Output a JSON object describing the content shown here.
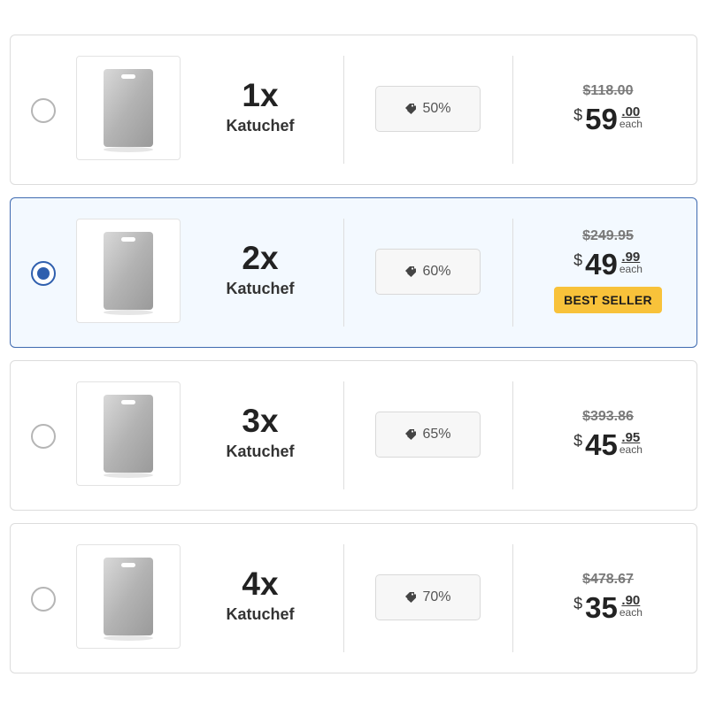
{
  "offers": [
    {
      "quantity": "1x",
      "product": "Katuchef",
      "discount": "50%",
      "original_price": "$118.00",
      "currency": "$",
      "price_whole": "59",
      "price_cents": ".00",
      "unit": "each",
      "selected": false,
      "badge": ""
    },
    {
      "quantity": "2x",
      "product": "Katuchef",
      "discount": "60%",
      "original_price": "$249.95",
      "currency": "$",
      "price_whole": "49",
      "price_cents": ".99",
      "unit": "each",
      "selected": true,
      "badge": "BEST SELLER"
    },
    {
      "quantity": "3x",
      "product": "Katuchef",
      "discount": "65%",
      "original_price": "$393.86",
      "currency": "$",
      "price_whole": "45",
      "price_cents": ".95",
      "unit": "each",
      "selected": false,
      "badge": ""
    },
    {
      "quantity": "4x",
      "product": "Katuchef",
      "discount": "70%",
      "original_price": "$478.67",
      "currency": "$",
      "price_whole": "35",
      "price_cents": ".90",
      "unit": "each",
      "selected": false,
      "badge": ""
    }
  ],
  "icons": {
    "discount": "tags-icon",
    "product_image": "cutting-board-image"
  },
  "colors": {
    "selected_border": "#3f6ab0",
    "selected_bg": "#f3f9ff",
    "radio_selected": "#2f5fae",
    "badge_bg": "#f8c23a"
  }
}
